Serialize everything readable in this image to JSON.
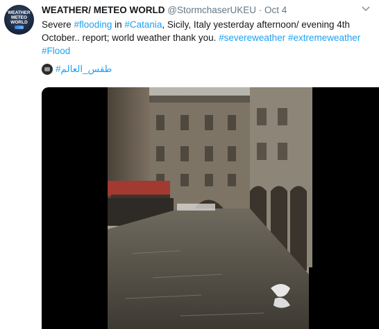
{
  "tweet": {
    "avatar_text": [
      "WEATHER",
      "METEO",
      "WORLD"
    ],
    "name": "WEATHER/ METEO WORLD",
    "handle": "@StormchaserUKEU",
    "separator": "·",
    "date": "Oct 4",
    "text_segments": [
      {
        "text": "Severe ",
        "type": "plain"
      },
      {
        "text": "#flooding",
        "type": "hashtag"
      },
      {
        "text": " in ",
        "type": "plain"
      },
      {
        "text": "#Catania",
        "type": "hashtag"
      },
      {
        "text": ", Sicily, Italy yesterday afternoon/ evening 4th October.. report; world weather thank you. ",
        "type": "plain"
      },
      {
        "text": "#severeweather",
        "type": "hashtag"
      },
      {
        "text": " ",
        "type": "plain"
      },
      {
        "text": "#extremeweather",
        "type": "hashtag"
      },
      {
        "text": " ",
        "type": "plain"
      },
      {
        "text": "#Flood",
        "type": "hashtag"
      }
    ],
    "arabic_hashtag": "طقس_العالم#"
  },
  "colors": {
    "hashtag": "#1da1f2",
    "secondary_text": "#657786",
    "primary_text": "#14171a"
  },
  "icons": {
    "menu_caret": "chevron-down-icon",
    "emoji": "flood-emoji-icon"
  }
}
